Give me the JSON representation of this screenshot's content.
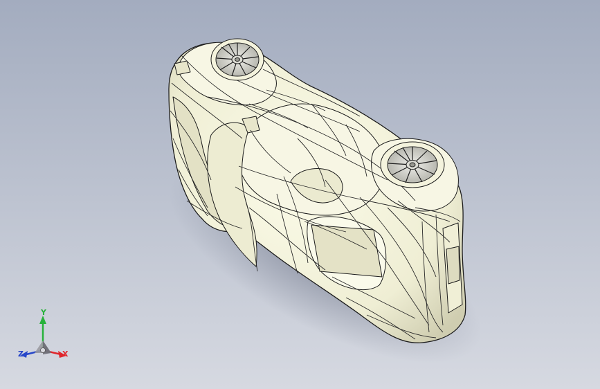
{
  "colors": {
    "background_top": "#a3acbf",
    "background_bottom": "#d6d9e1",
    "body_fill": "#f4f3dd",
    "body_shade": "#d7d5bb",
    "edge_line": "#1c1c1c",
    "x_axis": "#e0262c",
    "y_axis": "#27b23a",
    "z_axis": "#2646c9"
  },
  "model": {
    "subject": "car body",
    "view": "isometric"
  },
  "triad": {
    "x_label": "X",
    "y_label": "Y",
    "z_label": "Z"
  },
  "icons": [
    "triad-x-arrow-icon",
    "triad-y-arrow-icon",
    "triad-z-arrow-icon"
  ]
}
